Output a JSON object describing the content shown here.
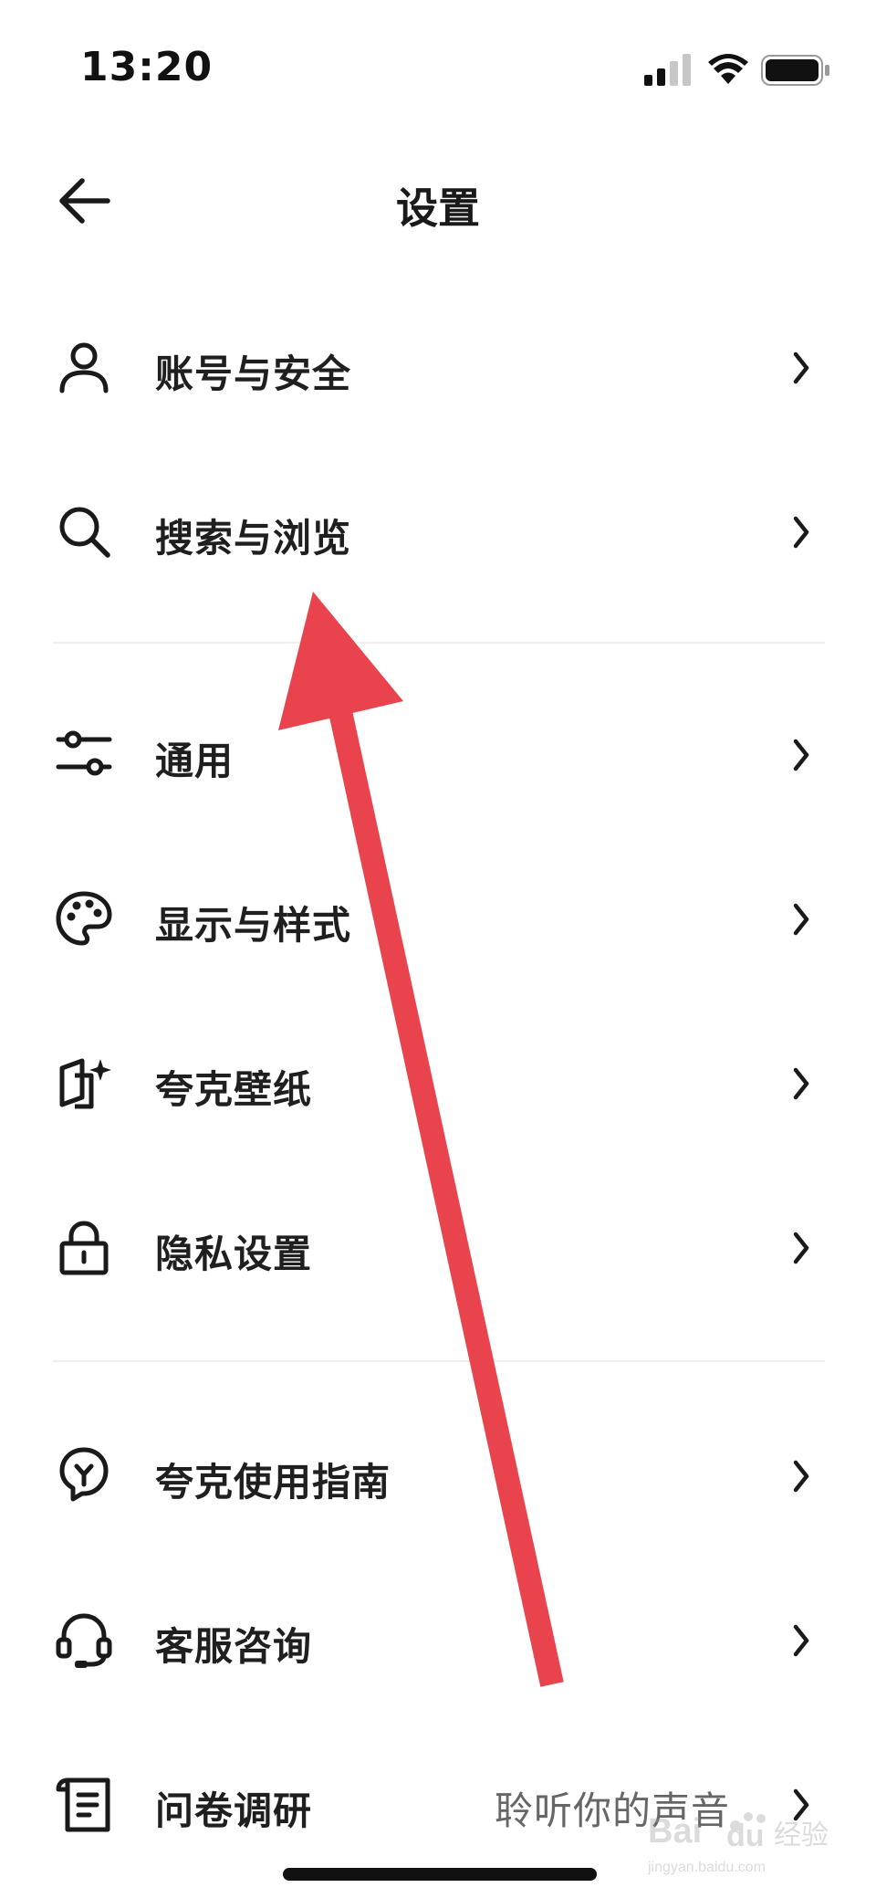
{
  "status_bar": {
    "time": "13:20",
    "icons": [
      "cellular-signal-icon",
      "wifi-icon",
      "battery-icon"
    ]
  },
  "nav": {
    "back_icon": "back-arrow-icon",
    "title": "设置"
  },
  "groups": [
    {
      "items": [
        {
          "id": "account",
          "icon": "user-icon",
          "label": "账号与安全",
          "value": ""
        },
        {
          "id": "search",
          "icon": "search-icon",
          "label": "搜索与浏览",
          "value": ""
        }
      ]
    },
    {
      "items": [
        {
          "id": "general",
          "icon": "sliders-icon",
          "label": "通用",
          "value": ""
        },
        {
          "id": "display",
          "icon": "palette-icon",
          "label": "显示与样式",
          "value": ""
        },
        {
          "id": "wallpaper",
          "icon": "wallpaper-icon",
          "label": "夸克壁纸",
          "value": ""
        },
        {
          "id": "privacy",
          "icon": "lock-icon",
          "label": "隐私设置",
          "value": ""
        }
      ]
    },
    {
      "items": [
        {
          "id": "guide",
          "icon": "lightbulb-icon",
          "label": "夸克使用指南",
          "value": ""
        },
        {
          "id": "support",
          "icon": "headset-icon",
          "label": "客服咨询",
          "value": ""
        },
        {
          "id": "survey",
          "icon": "survey-icon",
          "label": "问卷调研",
          "value": "聆听你的声音"
        }
      ]
    }
  ],
  "annotation": {
    "color": "#e9444d",
    "points_to": "search"
  },
  "watermark": {
    "text": "Bai du 经验",
    "subtext": "jingyan.baidu.com"
  },
  "colors": {
    "background": "#ffffff",
    "text": "#1f1f1f",
    "secondary_text": "#666666",
    "divider": "#efefef",
    "arrow": "#e9444d"
  }
}
